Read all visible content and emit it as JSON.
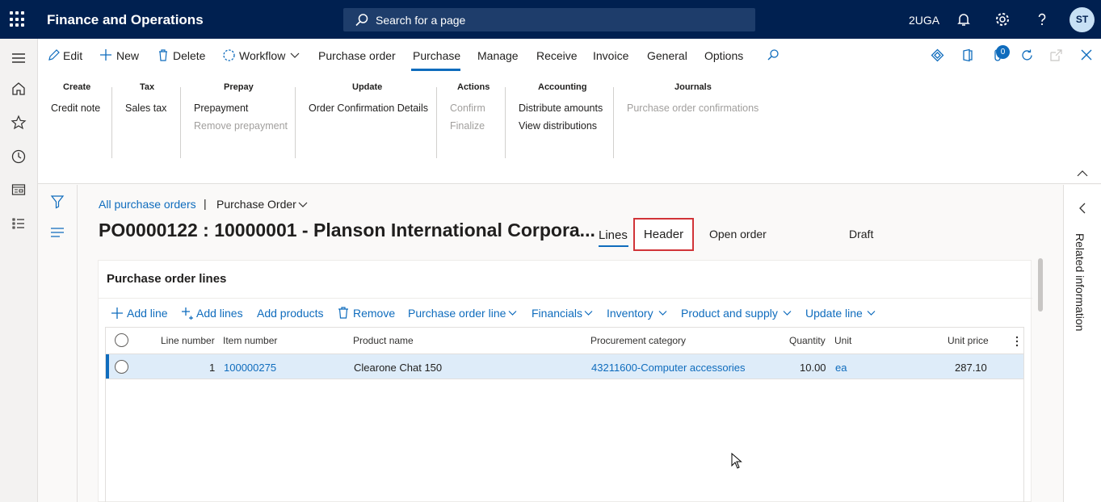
{
  "topbar": {
    "app_title": "Finance and Operations",
    "search_placeholder": "Search for a page",
    "company": "2UGA",
    "avatar_initials": "ST"
  },
  "actionbar": {
    "edit": "Edit",
    "new": "New",
    "delete": "Delete",
    "workflow": "Workflow",
    "tabs": [
      "Purchase order",
      "Purchase",
      "Manage",
      "Receive",
      "Invoice",
      "General",
      "Options"
    ],
    "active_tab": "Purchase",
    "badge_count": "0"
  },
  "ribbon": {
    "groups": [
      {
        "title": "Create",
        "items": [
          "Credit note"
        ]
      },
      {
        "title": "Tax",
        "items": [
          "Sales tax"
        ]
      },
      {
        "title": "Prepay",
        "items": [
          "Prepayment",
          "Remove prepayment"
        ]
      },
      {
        "title": "Update",
        "items": [
          "Order Confirmation Details"
        ]
      },
      {
        "title": "Actions",
        "items": [
          "Confirm",
          "Finalize"
        ]
      },
      {
        "title": "Accounting",
        "items": [
          "Distribute amounts",
          "View distributions"
        ]
      },
      {
        "title": "Journals",
        "items": [
          "Purchase order confirmations"
        ]
      }
    ]
  },
  "breadcrumb": {
    "link": "All purchase orders",
    "separator": "|",
    "current": "Purchase Order"
  },
  "page": {
    "title": "PO0000122 : 10000001 - Planson International Corpora...",
    "view_lines": "Lines",
    "view_header": "Header",
    "status_1": "Open order",
    "status_2": "Draft"
  },
  "lines_card": {
    "title": "Purchase order lines",
    "toolbar": [
      "Add line",
      "Add lines",
      "Add products",
      "Remove",
      "Purchase order line",
      "Financials",
      "Inventory",
      "Product and supply",
      "Update line"
    ],
    "columns": [
      "Line number",
      "Item number",
      "Product name",
      "Procurement category",
      "Quantity",
      "Unit",
      "Unit price"
    ],
    "rows": [
      {
        "line_number": "1",
        "item_number": "100000275",
        "product_name": "Clearone Chat 150",
        "procurement_category": "43211600-Computer accessories",
        "quantity": "10.00",
        "unit": "ea",
        "unit_price": "287.10"
      }
    ]
  },
  "related": {
    "label": "Related information"
  },
  "colors": {
    "navy": "#002050",
    "accent": "#0f6cbd",
    "highlight_box": "#d13438",
    "selected_row": "#deecf9"
  }
}
